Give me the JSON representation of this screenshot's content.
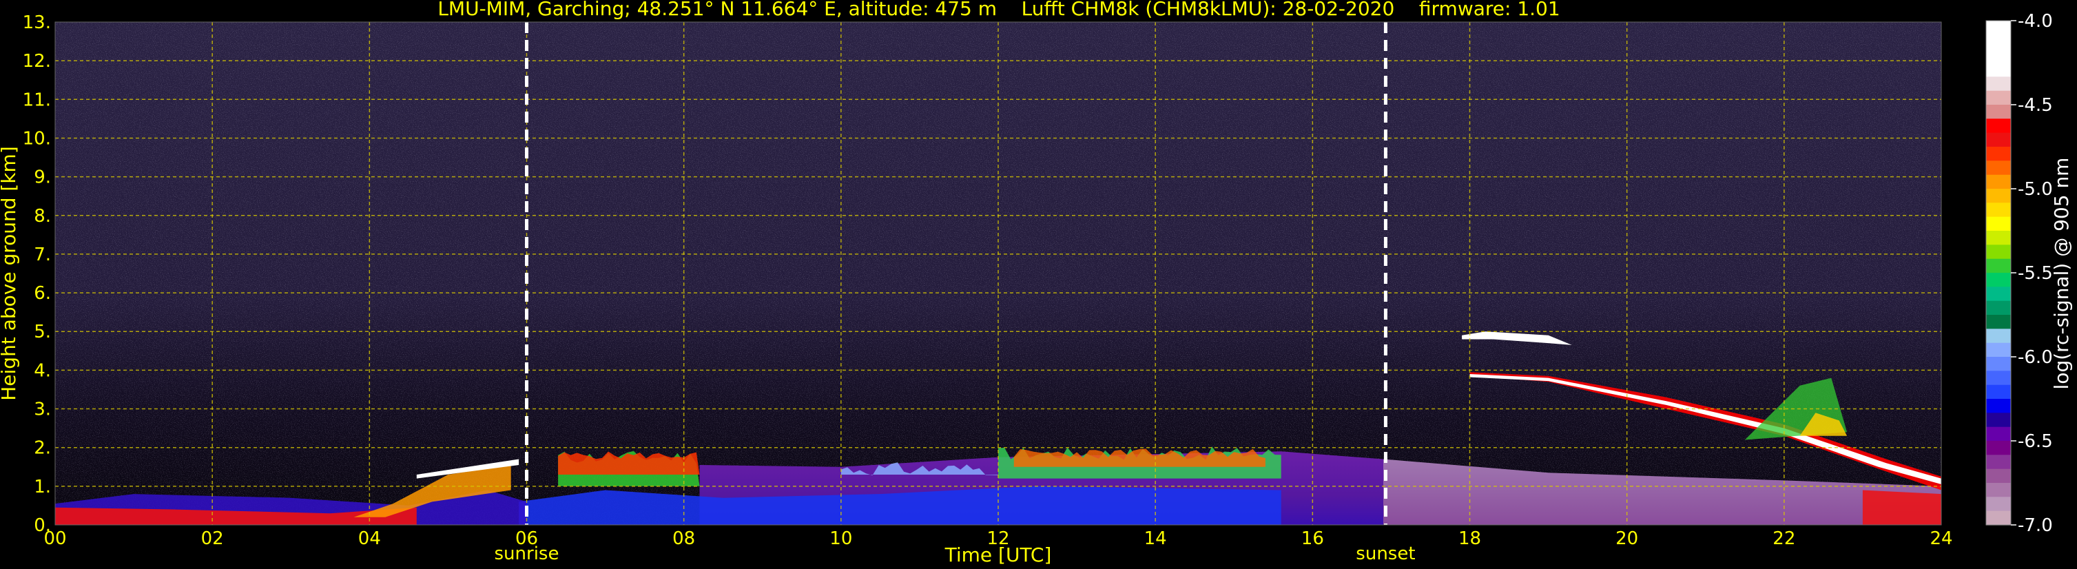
{
  "chart_data": {
    "type": "heatmap",
    "title": "LMU-MIM, Garching; 48.251° N 11.664° E, altitude: 475 m    Lufft CHM8k (CHM8kLMU): 28-02-2020    firmware: 1.01",
    "xlabel": "Time [UTC]",
    "ylabel": "Height above ground [km]",
    "xlim": [
      0,
      24
    ],
    "ylim": [
      0,
      13
    ],
    "x_ticks": [
      "00",
      "02",
      "04",
      "06",
      "08",
      "10",
      "12",
      "14",
      "16",
      "18",
      "20",
      "22",
      "24"
    ],
    "y_ticks": [
      "0.",
      "1.",
      "2.",
      "3.",
      "4.",
      "5.",
      "6.",
      "7.",
      "8.",
      "9.",
      "10.",
      "11.",
      "12.",
      "13."
    ],
    "grid": true,
    "events": [
      {
        "label": "sunrise",
        "x": 6.0
      },
      {
        "label": "sunset",
        "x": 16.93
      }
    ],
    "colorbar": {
      "label": "log(rc-signal) @ 905 nm",
      "range": [
        -7.0,
        -4.0
      ],
      "ticks": [
        "-4.0",
        "-4.5",
        "-5.0",
        "-5.5",
        "-6.0",
        "-6.5",
        "-7.0"
      ],
      "colors": [
        "#ffffff",
        "#ffffff",
        "#ffffff",
        "#ffffff",
        "#eedde0",
        "#e6b0b0",
        "#dd8c8c",
        "#ff0000",
        "#ee1111",
        "#ff3300",
        "#ff6600",
        "#ff9900",
        "#ffbb00",
        "#ffdd00",
        "#ffff00",
        "#ccee00",
        "#88dd00",
        "#33cc33",
        "#00cc66",
        "#00bb88",
        "#009966",
        "#007744",
        "#99ccee",
        "#88aaff",
        "#6688ff",
        "#4466ff",
        "#2244ff",
        "#0000ee",
        "#220099",
        "#6600aa",
        "#770088",
        "#883399",
        "#995599",
        "#aa77aa",
        "#bb99bb",
        "#ccaabb"
      ]
    },
    "features": [
      {
        "name": "boundary layer aerosol",
        "x": [
          0,
          24
        ],
        "height_km": [
          0,
          2.0
        ]
      },
      {
        "name": "aerosol layer top",
        "x": [
          6.4,
          15.6
        ],
        "height_km": [
          1.6,
          2.1
        ]
      },
      {
        "name": "cloud layer",
        "x": [
          17.9,
          19.3
        ],
        "height_km": [
          4.6,
          5.0
        ]
      },
      {
        "name": "descending cloud band",
        "x": [
          18.0,
          24.0
        ],
        "height_km": [
          4.0,
          1.0
        ]
      }
    ]
  }
}
